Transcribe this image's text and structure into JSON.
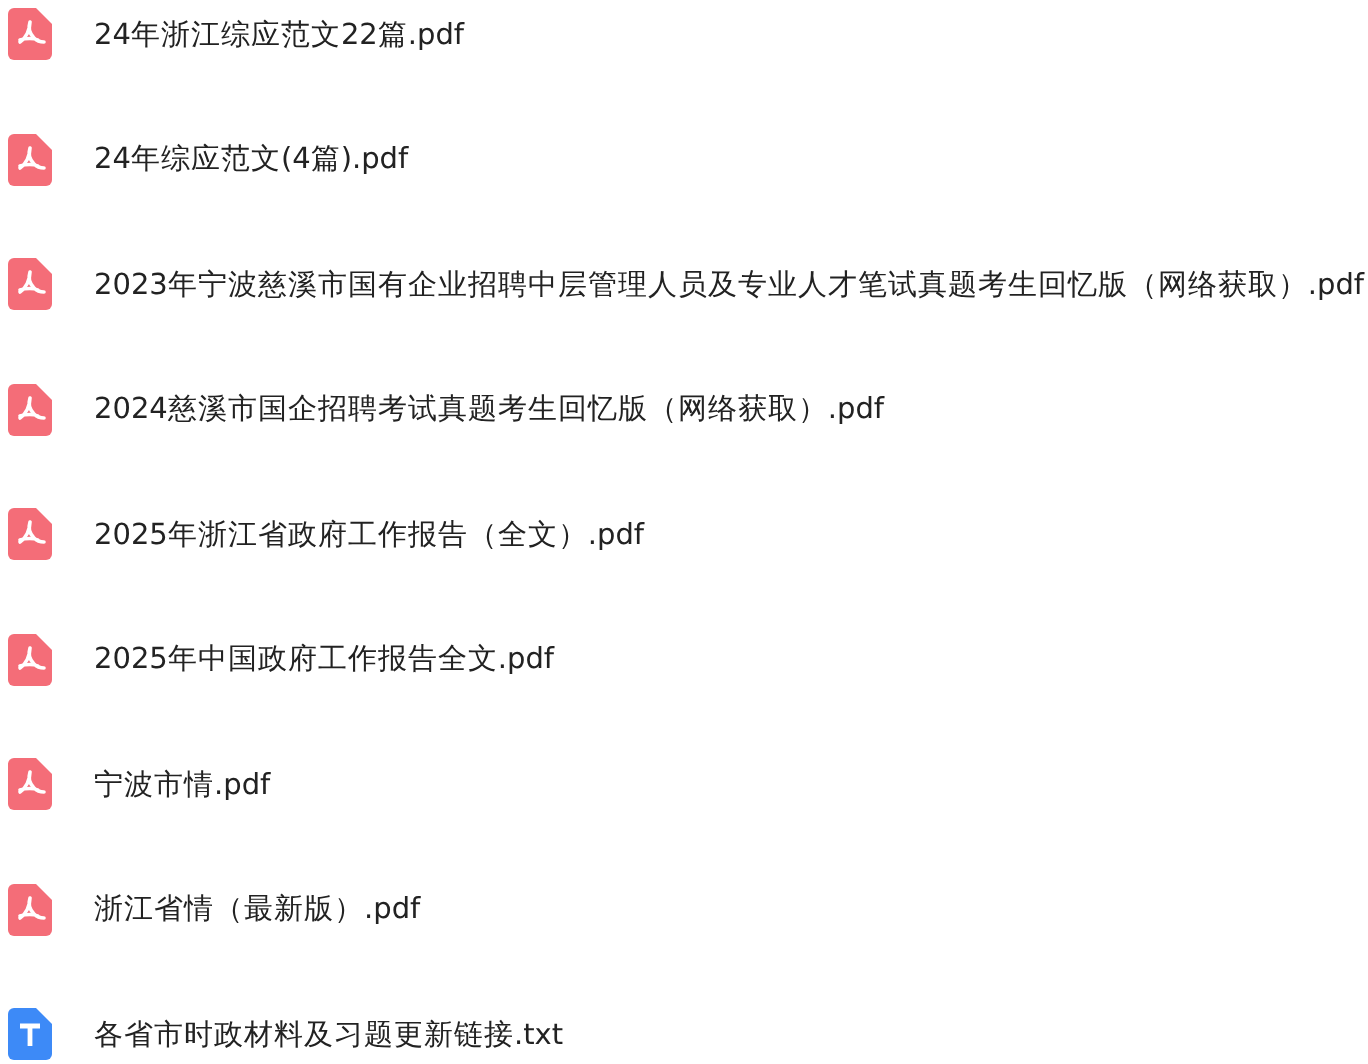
{
  "files": [
    {
      "kind": "pdf",
      "name": "24年浙江综应范文22篇.pdf"
    },
    {
      "kind": "pdf",
      "name": "24年综应范文(4篇).pdf"
    },
    {
      "kind": "pdf",
      "name": "2023年宁波慈溪市国有企业招聘中层管理人员及专业人才笔试真题考生回忆版（网络获取）.pdf"
    },
    {
      "kind": "pdf",
      "name": "2024慈溪市国企招聘考试真题考生回忆版（网络获取）.pdf"
    },
    {
      "kind": "pdf",
      "name": "2025年浙江省政府工作报告（全文）.pdf"
    },
    {
      "kind": "pdf",
      "name": "2025年中国政府工作报告全文.pdf"
    },
    {
      "kind": "pdf",
      "name": "宁波市情.pdf"
    },
    {
      "kind": "pdf",
      "name": "浙江省情（最新版）.pdf"
    },
    {
      "kind": "txt",
      "name": "各省市时政材料及习题更新链接.txt"
    }
  ]
}
